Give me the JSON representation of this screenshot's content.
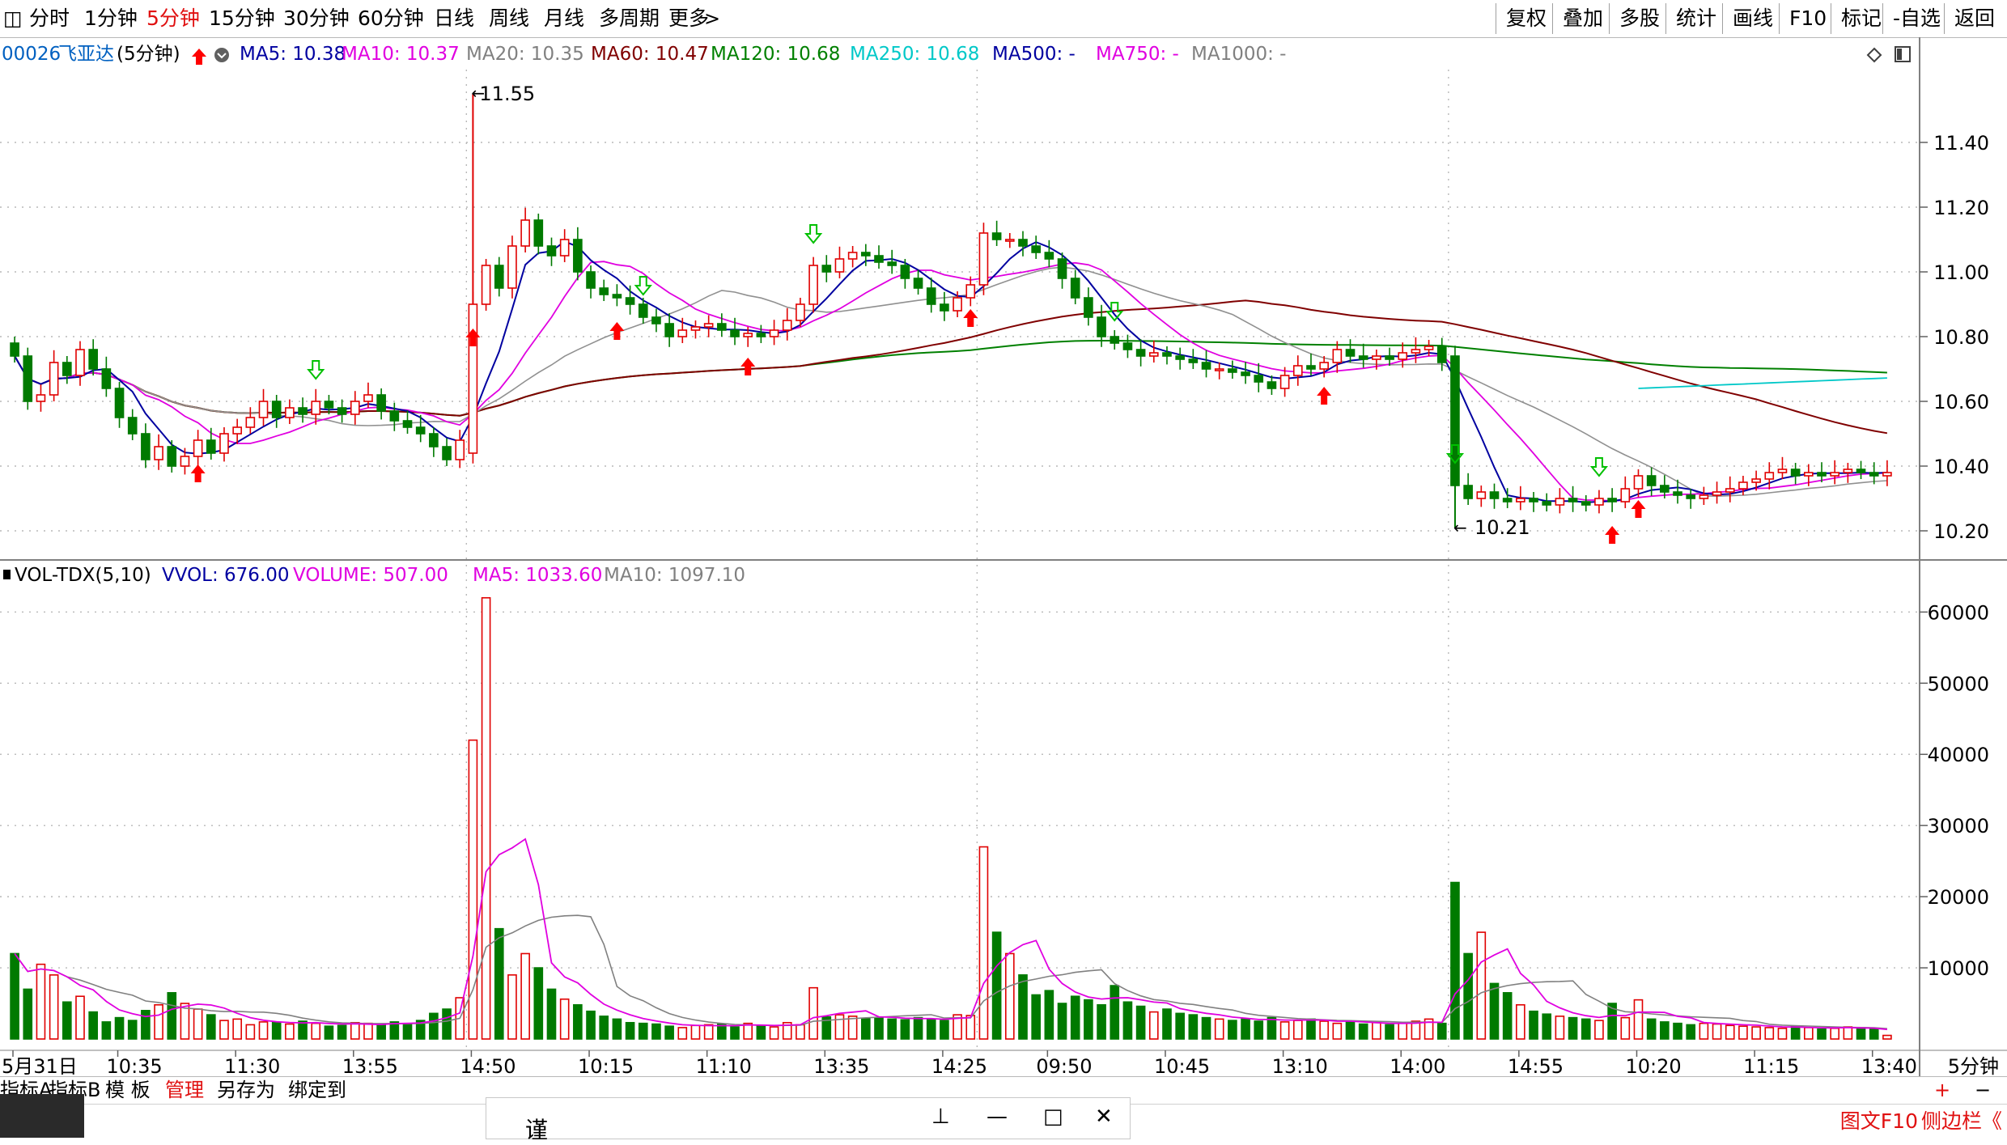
{
  "toolbar": {
    "menu_icon": "menu-icon",
    "periods": [
      {
        "label": "分时",
        "active": false
      },
      {
        "label": "1分钟",
        "active": false
      },
      {
        "label": "5分钟",
        "active": true
      },
      {
        "label": "15分钟",
        "active": false
      },
      {
        "label": "30分钟",
        "active": false
      },
      {
        "label": "60分钟",
        "active": false
      },
      {
        "label": "日线",
        "active": false
      },
      {
        "label": "周线",
        "active": false
      },
      {
        "label": "月线",
        "active": false
      },
      {
        "label": "多周期",
        "active": false
      },
      {
        "label": "更多",
        "active": false
      }
    ],
    "more_icon": "chevron-right-icon",
    "right_buttons": [
      "复权",
      "叠加",
      "多股",
      "统计",
      "画线",
      "F10",
      "标记",
      "-自选",
      "返回"
    ]
  },
  "legend": {
    "stock_code": "00026",
    "stock_name": "飞亚达",
    "period": "(5分钟)",
    "ma_items": [
      {
        "label": "MA5: 10.38",
        "color": "#0000a0"
      },
      {
        "label": "MA10: 10.37",
        "color": "#e000e0"
      },
      {
        "label": "MA20: 10.35",
        "color": "#808080"
      },
      {
        "label": "MA60: 10.47",
        "color": "#800000"
      },
      {
        "label": "MA120: 10.68",
        "color": "#008000"
      },
      {
        "label": "MA250: 10.68",
        "color": "#00c8c8"
      },
      {
        "label": "MA500: -",
        "color": "#0000a0"
      },
      {
        "label": "MA750: -",
        "color": "#e000e0"
      },
      {
        "label": "MA1000: -",
        "color": "#808080"
      }
    ]
  },
  "vol_legend": [
    {
      "label": "VOL-TDX(5,10)",
      "color": "#000000"
    },
    {
      "label": "VVOL: 676.00",
      "color": "#0000a0"
    },
    {
      "label": "VOLUME: 507.00",
      "color": "#e000e0"
    },
    {
      "label": "MA5: 1033.60",
      "color": "#e000e0"
    },
    {
      "label": "MA10: 1097.10",
      "color": "#808080"
    }
  ],
  "colors": {
    "up": "#e00000",
    "down": "#007a00",
    "ma5": "#0000a0",
    "ma10": "#e000e0",
    "ma20": "#909090",
    "ma60": "#800000",
    "ma120": "#008000",
    "ma250": "#00c8c8",
    "grid": "#b8b8b8"
  },
  "chart_data": [
    {
      "type": "candlestick",
      "title": "飞亚达 5分钟",
      "ylim": [
        10.15,
        11.6
      ],
      "yticks": [
        10.2,
        10.4,
        10.6,
        10.8,
        11.0,
        11.2,
        11.4
      ],
      "ytick_labels": [
        "10.20",
        "10.40",
        "10.60",
        "10.80",
        "11.00",
        "11.20",
        "11.40"
      ],
      "xtick_labels": [
        "5月31日",
        "10:35",
        "11:30",
        "13:55",
        "14:50",
        "10:15",
        "11:10",
        "13:35",
        "14:25",
        "09:50",
        "10:45",
        "13:10",
        "14:00",
        "14:55",
        "10:20",
        "11:15",
        "13:40"
      ],
      "max_label": "11.55",
      "min_label": "10.21",
      "closes": [
        10.74,
        10.6,
        10.62,
        10.72,
        10.68,
        10.76,
        10.7,
        10.64,
        10.55,
        10.5,
        10.42,
        10.46,
        10.4,
        10.43,
        10.48,
        10.44,
        10.5,
        10.52,
        10.55,
        10.6,
        10.55,
        10.58,
        10.56,
        10.6,
        10.58,
        10.56,
        10.6,
        10.62,
        10.57,
        10.54,
        10.52,
        10.5,
        10.46,
        10.42,
        10.48,
        10.9,
        11.02,
        10.95,
        11.08,
        11.16,
        11.08,
        11.05,
        11.1,
        11.0,
        10.95,
        10.93,
        10.92,
        10.9,
        10.86,
        10.84,
        10.8,
        10.82,
        10.83,
        10.84,
        10.82,
        10.8,
        10.81,
        10.8,
        10.82,
        10.85,
        10.9,
        11.02,
        11.0,
        11.04,
        11.06,
        11.05,
        11.03,
        11.02,
        10.98,
        10.95,
        10.9,
        10.88,
        10.92,
        10.96,
        11.12,
        11.1,
        11.1,
        11.08,
        11.06,
        11.04,
        10.98,
        10.92,
        10.86,
        10.8,
        10.78,
        10.76,
        10.74,
        10.75,
        10.74,
        10.73,
        10.72,
        10.7,
        10.7,
        10.69,
        10.68,
        10.66,
        10.64,
        10.68,
        10.71,
        10.7,
        10.72,
        10.76,
        10.74,
        10.73,
        10.74,
        10.73,
        10.75,
        10.76,
        10.77,
        10.72,
        10.34,
        10.3,
        10.32,
        10.3,
        10.29,
        10.3,
        10.29,
        10.28,
        10.3,
        10.29,
        10.28,
        10.3,
        10.29,
        10.33,
        10.37,
        10.34,
        10.32,
        10.31,
        10.3,
        10.31,
        10.32,
        10.33,
        10.35,
        10.36,
        10.38,
        10.39,
        10.37,
        10.38,
        10.37,
        10.38,
        10.39,
        10.38,
        10.37,
        10.38
      ],
      "volumes": [
        12000,
        7000,
        10500,
        9000,
        5200,
        6000,
        3800,
        2400,
        3000,
        2600,
        4000,
        4800,
        6500,
        5000,
        4200,
        3400,
        2600,
        2800,
        2000,
        2400,
        2300,
        2100,
        2500,
        2200,
        1800,
        1900,
        2300,
        2200,
        2000,
        2400,
        2100,
        2600,
        3600,
        4200,
        5800,
        42000,
        62000,
        15500,
        9000,
        12000,
        10000,
        7000,
        5600,
        4800,
        3900,
        3200,
        2800,
        2300,
        2200,
        2100,
        1800,
        1600,
        1900,
        2000,
        2100,
        1700,
        2200,
        1800,
        1700,
        2300,
        2000,
        7200,
        3100,
        3400,
        3200,
        2900,
        3000,
        2800,
        2700,
        3000,
        2800,
        2600,
        3400,
        3300,
        27000,
        15000,
        12000,
        9000,
        6200,
        6800,
        5000,
        6000,
        5500,
        4800,
        7500,
        5200,
        4600,
        3800,
        4200,
        3600,
        3400,
        3000,
        2800,
        2600,
        2800,
        2500,
        3000,
        2400,
        2600,
        2800,
        2500,
        2200,
        2400,
        2100,
        2300,
        2000,
        2200,
        2500,
        2800,
        2200,
        22000,
        12000,
        15000,
        7800,
        6500,
        4800,
        3900,
        3500,
        3200,
        3000,
        2800,
        2600,
        5000,
        3000,
        5500,
        2800,
        2400,
        2200,
        2000,
        2200,
        2100,
        1900,
        1800,
        1700,
        1600,
        1500,
        1800,
        1600,
        1400,
        1500,
        1700,
        1600,
        1400,
        507
      ],
      "vol_ylim": [
        0,
        68000
      ],
      "vol_yticks": [
        10000,
        20000,
        30000,
        40000,
        50000,
        60000
      ],
      "vol_ytick_labels": [
        "10000",
        "20000",
        "30000",
        "40000",
        "50000",
        "60000"
      ],
      "period_label": "5分钟"
    }
  ],
  "status": {
    "tabs": [
      "指标A",
      "指标B",
      "模 板",
      "管理",
      "另存为",
      "绑定到"
    ],
    "active_tab": "管理",
    "zoom_in": "+",
    "zoom_out": "−"
  },
  "footer": {
    "window_pin": "pin-icon",
    "window_min": "minimize-icon",
    "window_max": "maximize-icon",
    "window_close": "close-icon",
    "f10_link": "图文F10",
    "sidebar_link": "侧边栏《",
    "partial_text": "谨"
  }
}
